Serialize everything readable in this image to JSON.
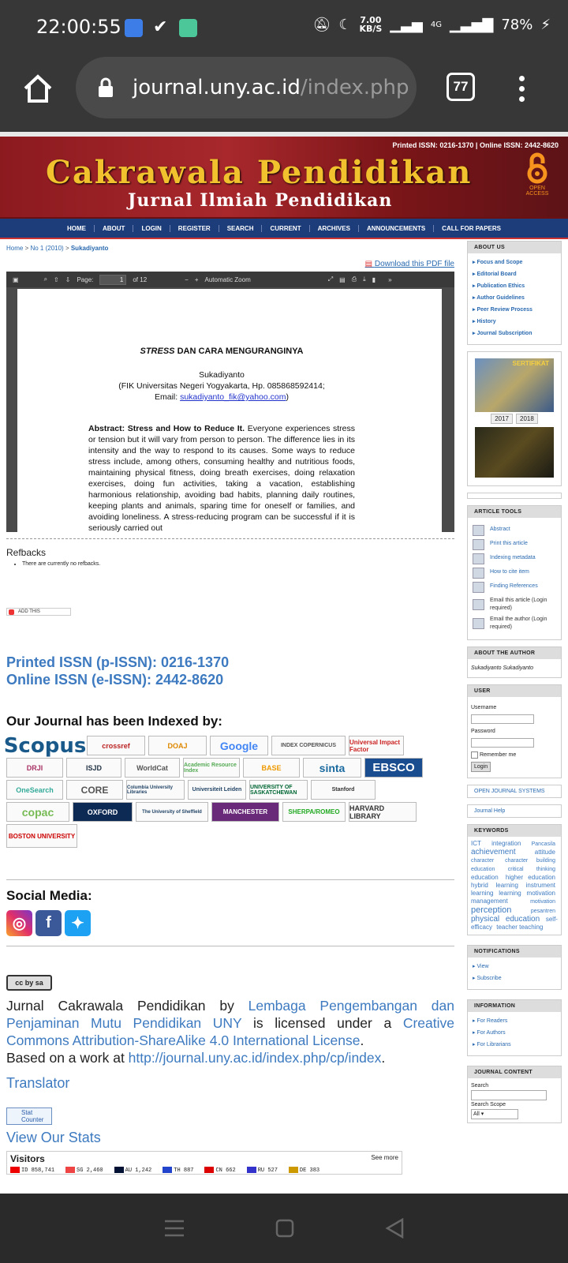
{
  "status": {
    "time": "22:00:55",
    "speed": "7.00\nKB/S",
    "network": "4G",
    "battery": "78%"
  },
  "browser": {
    "url_host": "journal.uny.ac.id",
    "url_path": "/index.php",
    "tab_count": "77"
  },
  "banner": {
    "issn": "Printed ISSN: 0216-1370  |  Online ISSN: 2442-8620",
    "title": "Cakrawala Pendidikan",
    "subtitle": "Jurnal Ilmiah Pendidikan",
    "open_access": "OPEN ACCESS"
  },
  "nav": [
    "HOME",
    "ABOUT",
    "LOGIN",
    "REGISTER",
    "SEARCH",
    "CURRENT",
    "ARCHIVES",
    "ANNOUNCEMENTS",
    "CALL FOR PAPERS"
  ],
  "breadcrumb": {
    "home": "Home",
    "issue": "No 1 (2010)",
    "current": "Sukadiyanto"
  },
  "download": "Download this PDF file",
  "pdf": {
    "page_label": "Page:",
    "page": "1",
    "of": "of 12",
    "zoom": "Automatic Zoom",
    "title_italic": "STRESS",
    "title_rest": " DAN CARA MENGURANGINYA",
    "author": "Sukadiyanto",
    "affil": "(FIK Universitas Negeri Yogyakarta, Hp. 085868592414;",
    "email_label": "Email: ",
    "email": "sukadiyanto_fik@yahoo.com",
    "abstract_head": "Abstract: Stress and How to Reduce It.",
    "abstract": " Everyone experiences stress or tension but it will vary from person to person. The difference lies in its intensity and the way to respond to its causes. Some ways to reduce stress include, among others, consuming healthy and nutritious foods, maintaining physical fitness, doing breath exercises, doing relaxation exercises, doing fun activities, taking a vacation, establishing harmonious relationship, avoiding bad habits, planning daily routines, keeping plants and animals, sparing time for oneself or families, and avoiding loneliness. A stress-reducing program can be successful if it is seriously carried out"
  },
  "refbacks": {
    "title": "Refbacks",
    "item": "There are currently no refbacks."
  },
  "addthis": "ADD THIS",
  "issn": {
    "print": "Printed ISSN (p-ISSN): 0216-1370",
    "online": "Online ISSN (e-ISSN): 2442-8620"
  },
  "indexed_title": "Our Journal has been Indexed by:",
  "indexers": [
    "Scopus",
    "crossref",
    "DOAJ",
    "Google",
    "INDEX COPERNICUS",
    "Universal Impact Factor",
    "DRJI",
    "ISJD",
    "WorldCat",
    "Academic Resource Index",
    "BASE",
    "sinta",
    "EBSCO",
    "OneSearch",
    "CORE",
    "Columbia University Libraries",
    "Universiteit Leiden",
    "UNIVERSITY OF SASKATCHEWAN",
    "Stanford",
    "copac",
    "OXFORD",
    "The University of Sheffield",
    "MANCHESTER",
    "SHERPA/ROMEO",
    "HARVARD LIBRARY",
    "BOSTON UNIVERSITY"
  ],
  "social_title": "Social Media:",
  "license": {
    "cc": "cc by sa",
    "p1": "Jurnal Cakrawala Pendidikan by ",
    "org": "Lembaga Pengembangan dan Penjaminan Mutu Pendidikan UNY",
    "p2": " is licensed under a ",
    "lic": "Creative Commons Attribution-ShareAlike 4.0 International License",
    "p3": ".",
    "based": "Based on a work at ",
    "url": "http://journal.uny.ac.id/index.php/cp/index",
    "p4": "."
  },
  "translator": "Translator",
  "statcounter": "Stat Counter",
  "view_stats": "View Our Stats",
  "visitors": {
    "title": "Visitors",
    "see_more": "See more",
    "rows": [
      {
        "code": "ID",
        "count": "858,741",
        "color": "#e00"
      },
      {
        "code": "SG",
        "count": "2,460",
        "color": "#e44"
      },
      {
        "code": "AU",
        "count": "1,242",
        "color": "#013"
      },
      {
        "code": "TH",
        "count": "887",
        "color": "#24c"
      },
      {
        "code": "CN",
        "count": "662",
        "color": "#d00"
      },
      {
        "code": "RU",
        "count": "527",
        "color": "#33c"
      },
      {
        "code": "DE",
        "count": "383",
        "color": "#c90"
      }
    ]
  },
  "sidebar": {
    "about_title": "ABOUT US",
    "about": [
      "Focus and Scope",
      "Editorial Board",
      "Publication Ethics",
      "Author Guidelines",
      "Peer Review Process",
      "History",
      "Journal Subscription"
    ],
    "cert_label": "SERTIFIKAT",
    "years": [
      "2017",
      "2018"
    ],
    "tools_title": "ARTICLE TOOLS",
    "tools": [
      "Abstract",
      "Print this article",
      "Indexing metadata",
      "How to cite item",
      "Finding References",
      "Email this article (Login required)",
      "Email the author (Login required)"
    ],
    "author_title": "ABOUT THE AUTHOR",
    "author": "Sukadiyanto Sukadiyanto",
    "user_title": "USER",
    "username": "Username",
    "password": "Password",
    "remember": "Remember me",
    "login": "Login",
    "ojs": "OPEN JOURNAL SYSTEMS",
    "help": "Journal Help",
    "kw_title": "KEYWORDS",
    "keywords": [
      "ICT",
      "integration",
      "Pancasila",
      "achievement",
      "attitude",
      "character",
      "character building",
      "education",
      "critical",
      "thinking",
      "education",
      "higher education",
      "hybrid",
      "learning",
      "instrument",
      "learning",
      "learning",
      "motivation",
      "management",
      "motivation",
      "perception",
      "pesantren",
      "physical",
      "education",
      "self-efficacy",
      "teacher teaching"
    ],
    "notif_title": "NOTIFICATIONS",
    "notif": [
      "View",
      "Subscribe"
    ],
    "info_title": "INFORMATION",
    "info": [
      "For Readers",
      "For Authors",
      "For Librarians"
    ],
    "content_title": "JOURNAL CONTENT",
    "search": "Search",
    "scope": "Search Scope",
    "scope_val": "All"
  }
}
